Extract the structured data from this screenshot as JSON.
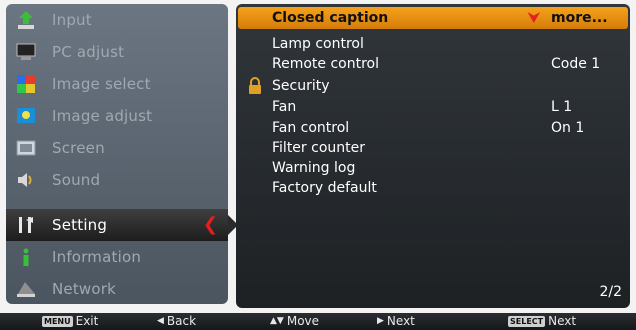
{
  "left_menu": {
    "items": [
      {
        "label": "Input",
        "icon": "input-icon"
      },
      {
        "label": "PC adjust",
        "icon": "pc-adjust-icon"
      },
      {
        "label": "Image select",
        "icon": "image-select-icon"
      },
      {
        "label": "Image adjust",
        "icon": "image-adjust-icon"
      },
      {
        "label": "Screen",
        "icon": "screen-icon"
      },
      {
        "label": "Sound",
        "icon": "sound-icon"
      },
      {
        "label": "Setting",
        "icon": "setting-icon",
        "active": true
      },
      {
        "label": "Information",
        "icon": "information-icon"
      },
      {
        "label": "Network",
        "icon": "network-icon"
      }
    ]
  },
  "settings_panel": {
    "rows": [
      {
        "name": "Closed caption",
        "value": "more..."
      },
      {
        "name": "Lamp control",
        "value": ""
      },
      {
        "name": "Remote control",
        "value": "Code 1"
      },
      {
        "name": "Security",
        "value": ""
      },
      {
        "name": "Fan",
        "value": "L 1"
      },
      {
        "name": "Fan control",
        "value": "On 1"
      },
      {
        "name": "Filter counter",
        "value": ""
      },
      {
        "name": "Warning log",
        "value": ""
      },
      {
        "name": "Factory default",
        "value": ""
      }
    ],
    "page": "2/2"
  },
  "bottom_bar": {
    "exit_key": "MENU",
    "exit_label": "Exit",
    "back_label": "Back",
    "move_label": "Move",
    "next_label": "Next",
    "select_key": "SELECT",
    "select_label": "Next"
  },
  "colors": {
    "highlight": "#f0961a",
    "active_arrow": "#e61e1e",
    "panel_bg": "#2a2f34",
    "menu_bg": "#5d6873"
  }
}
